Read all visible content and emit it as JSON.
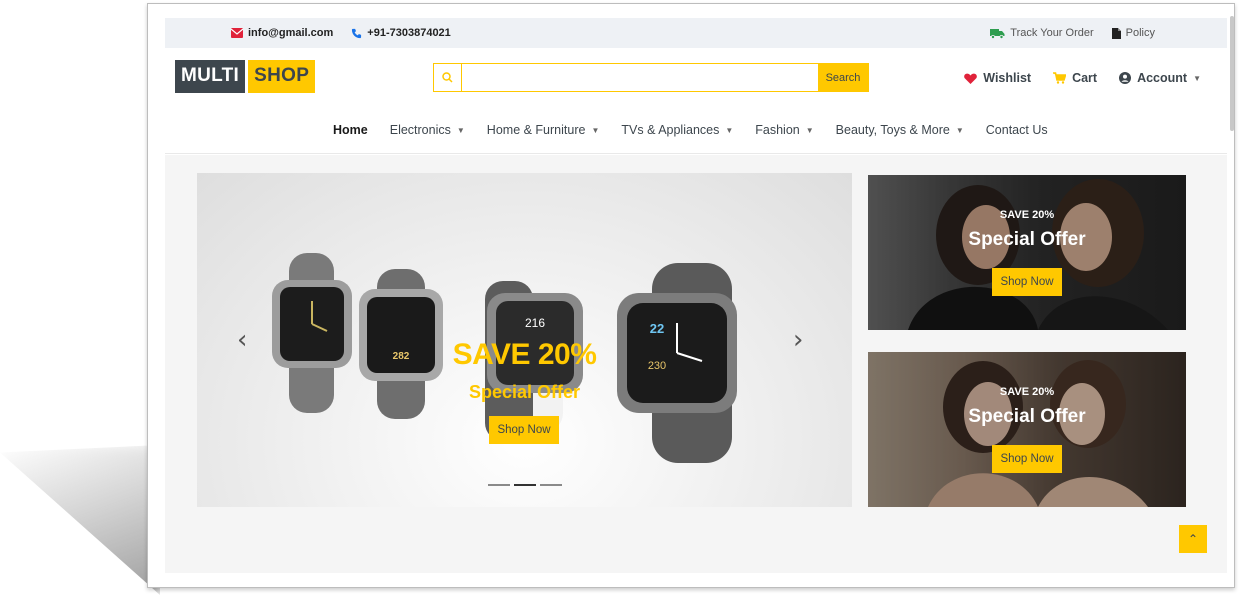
{
  "topbar": {
    "email": "info@gmail.com",
    "phone": "+91-7303874021",
    "track_order": "Track Your Order",
    "policy": "Policy"
  },
  "logo": {
    "part1": "MULTI",
    "part2": "SHOP"
  },
  "search": {
    "placeholder": "",
    "button": "Search"
  },
  "header_links": {
    "wishlist": "Wishlist",
    "cart": "Cart",
    "account": "Account"
  },
  "nav": {
    "items": [
      {
        "label": "Home",
        "dropdown": false
      },
      {
        "label": "Electronics",
        "dropdown": true
      },
      {
        "label": "Home & Furniture",
        "dropdown": true
      },
      {
        "label": "TVs & Appliances",
        "dropdown": true
      },
      {
        "label": "Fashion",
        "dropdown": true
      },
      {
        "label": "Beauty, Toys & More",
        "dropdown": true
      },
      {
        "label": "Contact Us",
        "dropdown": false
      }
    ]
  },
  "carousel": {
    "save_text": "SAVE 20%",
    "offer_text": "Special Offer",
    "button": "Shop Now",
    "active_slide": 2,
    "slides": 3,
    "prev_icon": "chevron-left-icon",
    "next_icon": "chevron-right-icon",
    "watch_faces": [
      "216",
      "22",
      "230",
      "282"
    ]
  },
  "promos": [
    {
      "save_text": "SAVE 20%",
      "offer_text": "Special Offer",
      "button": "Shop Now"
    },
    {
      "save_text": "SAVE 20%",
      "offer_text": "Special Offer",
      "button": "Shop Now"
    }
  ],
  "colors": {
    "accent": "#ffc800",
    "dark": "#3d464d",
    "heart": "#e0223a",
    "truck": "#2e9d4f",
    "phone": "#1a73e8",
    "mail": "#e0223a"
  },
  "back_to_top_icon": "double-chevron-up-icon"
}
